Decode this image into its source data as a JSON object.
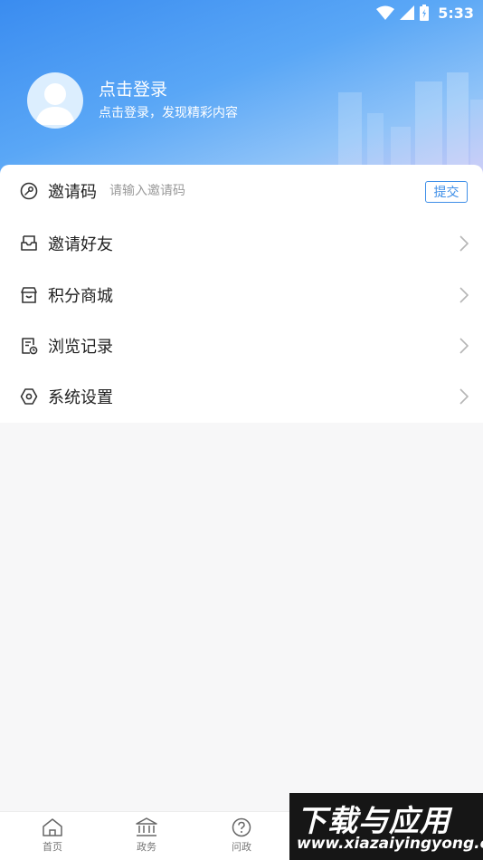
{
  "status_bar": {
    "time": "5:33"
  },
  "profile": {
    "title": "点击登录",
    "subtitle": "点击登录，发现精彩内容"
  },
  "invite": {
    "label": "邀请码",
    "placeholder": "请输入邀请码",
    "submit_label": "提交"
  },
  "menu": {
    "items": [
      {
        "label": "邀请好友",
        "icon": "inbox-icon"
      },
      {
        "label": "积分商城",
        "icon": "store-icon"
      },
      {
        "label": "浏览记录",
        "icon": "history-document-icon"
      },
      {
        "label": "系统设置",
        "icon": "settings-hexagon-icon"
      }
    ]
  },
  "tabbar": {
    "tabs": [
      {
        "label": "首页",
        "icon": "home-icon"
      },
      {
        "label": "政务",
        "icon": "government-building-icon"
      },
      {
        "label": "问政",
        "icon": "question-circle-icon"
      }
    ]
  },
  "watermark": {
    "title": "下载与应用",
    "url": "www.xiazaiyingyong.com"
  },
  "colors": {
    "accent": "#3f8fe8",
    "header_start": "#3a8cf0",
    "header_end": "#c9c6f6",
    "background": "#f7f7f8"
  }
}
